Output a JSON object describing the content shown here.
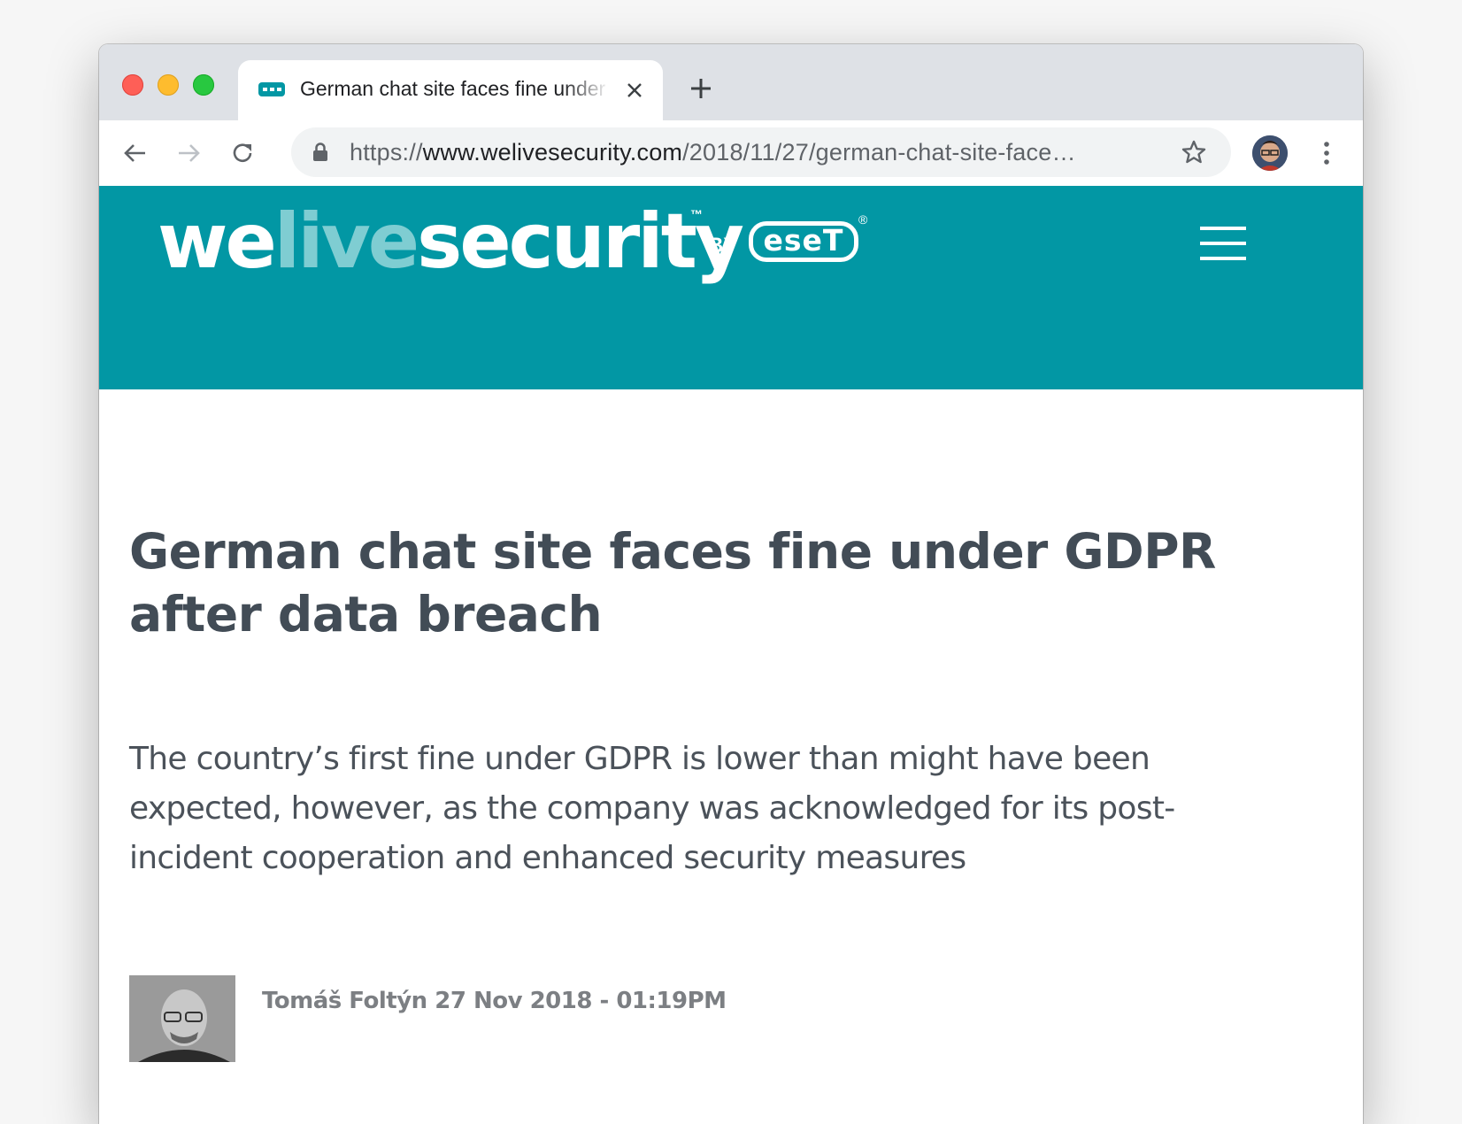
{
  "browser": {
    "tab_title": "German chat site faces fine under GDPR after data breach",
    "url_scheme": "https://",
    "url_host": "www.welivesecurity.com",
    "url_path": "/2018/11/27/german-chat-site-face…"
  },
  "site": {
    "logo_we": "we",
    "logo_live": "live",
    "logo_security": "security",
    "logo_tm": "™",
    "logo_by": "BY",
    "logo_eset": "eseT",
    "logo_reg": "®",
    "brand_color": "#0297a4"
  },
  "article": {
    "headline": "German chat site faces fine under GDPR after data breach",
    "standfirst": "The country’s first fine under GDPR is lower than might have been expected, however, as the company was acknowledged for its post-incident cooperation and enhanced security measures",
    "byline": "Tomáš Foltýn 27 Nov 2018 - 01:19PM"
  }
}
